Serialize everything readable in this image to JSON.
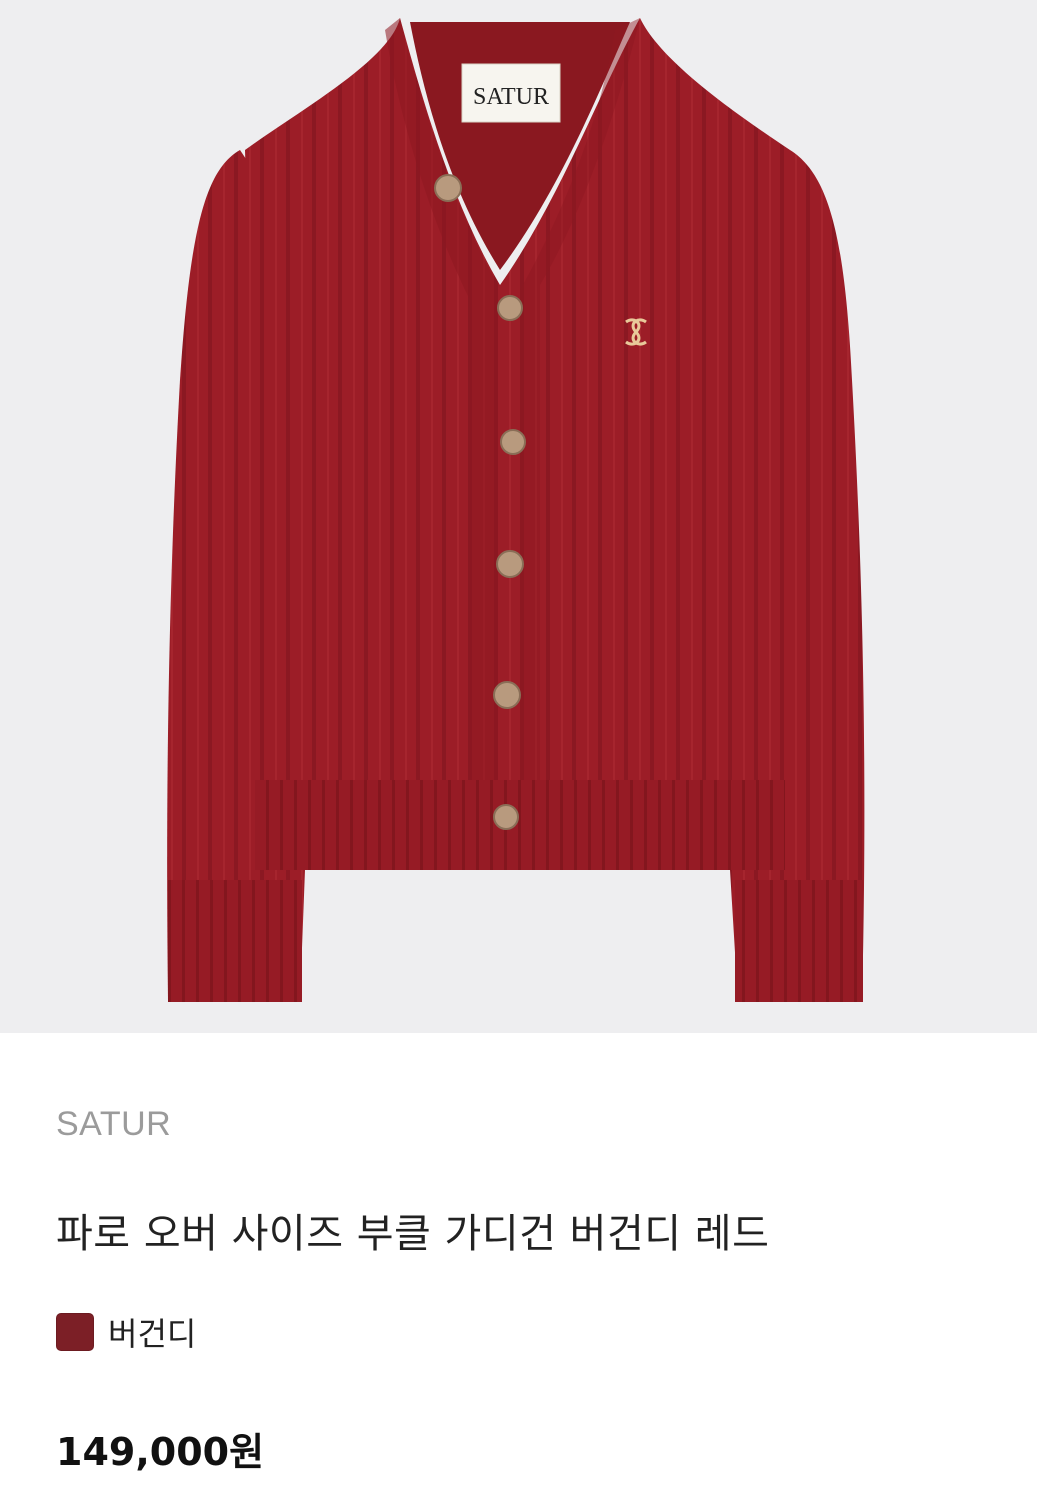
{
  "product": {
    "image_label": "SATUR",
    "brand": "SATUR",
    "title": "파로 오버 사이즈 부클 가디건 버건디 레드",
    "color": {
      "label": "버건디",
      "swatch_hex": "#7c1f26"
    },
    "price": "149,000원"
  },
  "colors": {
    "image_background": "#eeeef0",
    "knit": "#9c1d27",
    "knit_shadow": "#7d141d",
    "button": "#b89a7e",
    "brand_text": "#9b9b9b",
    "title_text": "#222222",
    "price_text": "#111111"
  }
}
